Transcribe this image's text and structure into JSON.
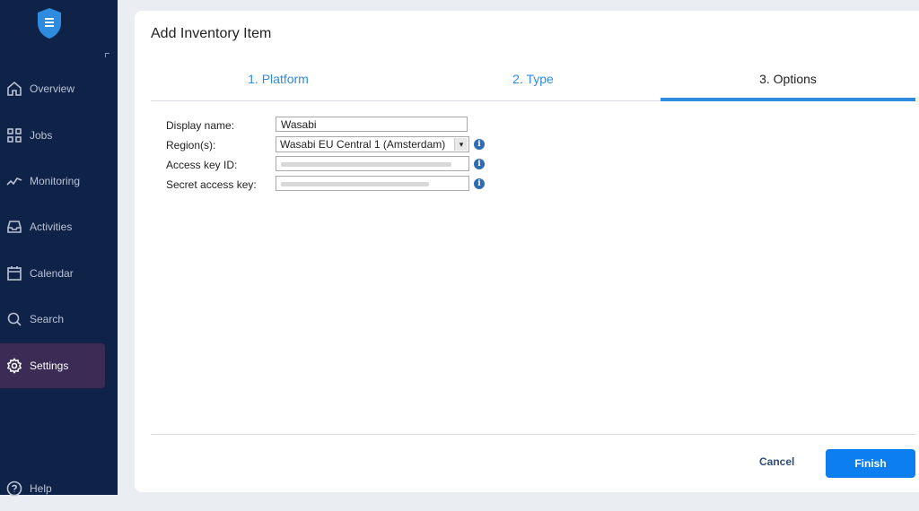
{
  "sidebar": {
    "items": [
      {
        "label": "Overview",
        "icon": "home-icon"
      },
      {
        "label": "Jobs",
        "icon": "grid-icon"
      },
      {
        "label": "Monitoring",
        "icon": "activity-line-icon"
      },
      {
        "label": "Activities",
        "icon": "inbox-icon"
      },
      {
        "label": "Calendar",
        "icon": "calendar-icon"
      },
      {
        "label": "Search",
        "icon": "search-icon"
      },
      {
        "label": "Settings",
        "icon": "gear-icon",
        "active": true
      },
      {
        "label": "Help",
        "icon": "help-icon"
      }
    ]
  },
  "dialog": {
    "title": "Add Inventory Item",
    "tabs": [
      {
        "label": "1. Platform"
      },
      {
        "label": "2. Type"
      },
      {
        "label": "3. Options",
        "active": true
      }
    ],
    "form": {
      "display_name": {
        "label": "Display name:",
        "value": "Wasabi"
      },
      "regions": {
        "label": "Region(s):",
        "value": "Wasabi EU Central 1 (Amsterdam)"
      },
      "access_key": {
        "label": "Access key ID:"
      },
      "secret_key": {
        "label": "Secret access key:"
      }
    },
    "cancel_label": "Cancel",
    "finish_label": "Finish"
  },
  "colors": {
    "sidebar_bg": "#0f2247",
    "accent": "#2d8be0",
    "finish_bg": "#0d7ef0",
    "active_nav": "#3b2b55"
  }
}
